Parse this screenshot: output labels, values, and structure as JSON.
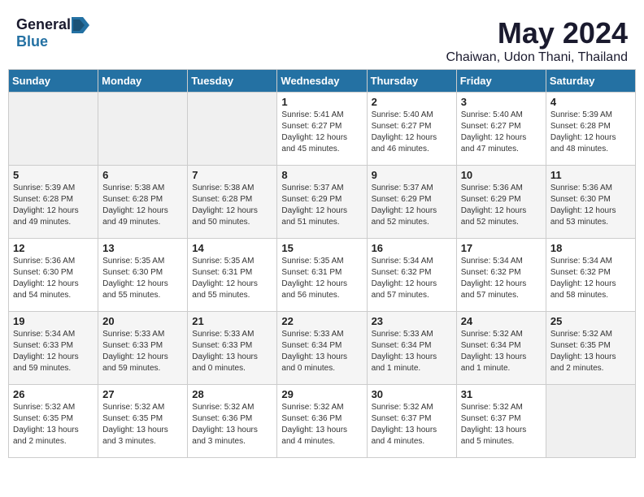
{
  "header": {
    "logo_general": "General",
    "logo_blue": "Blue",
    "month": "May 2024",
    "location": "Chaiwan, Udon Thani, Thailand"
  },
  "weekdays": [
    "Sunday",
    "Monday",
    "Tuesday",
    "Wednesday",
    "Thursday",
    "Friday",
    "Saturday"
  ],
  "weeks": [
    [
      {
        "day": "",
        "info": ""
      },
      {
        "day": "",
        "info": ""
      },
      {
        "day": "",
        "info": ""
      },
      {
        "day": "1",
        "info": "Sunrise: 5:41 AM\nSunset: 6:27 PM\nDaylight: 12 hours\nand 45 minutes."
      },
      {
        "day": "2",
        "info": "Sunrise: 5:40 AM\nSunset: 6:27 PM\nDaylight: 12 hours\nand 46 minutes."
      },
      {
        "day": "3",
        "info": "Sunrise: 5:40 AM\nSunset: 6:27 PM\nDaylight: 12 hours\nand 47 minutes."
      },
      {
        "day": "4",
        "info": "Sunrise: 5:39 AM\nSunset: 6:28 PM\nDaylight: 12 hours\nand 48 minutes."
      }
    ],
    [
      {
        "day": "5",
        "info": "Sunrise: 5:39 AM\nSunset: 6:28 PM\nDaylight: 12 hours\nand 49 minutes."
      },
      {
        "day": "6",
        "info": "Sunrise: 5:38 AM\nSunset: 6:28 PM\nDaylight: 12 hours\nand 49 minutes."
      },
      {
        "day": "7",
        "info": "Sunrise: 5:38 AM\nSunset: 6:28 PM\nDaylight: 12 hours\nand 50 minutes."
      },
      {
        "day": "8",
        "info": "Sunrise: 5:37 AM\nSunset: 6:29 PM\nDaylight: 12 hours\nand 51 minutes."
      },
      {
        "day": "9",
        "info": "Sunrise: 5:37 AM\nSunset: 6:29 PM\nDaylight: 12 hours\nand 52 minutes."
      },
      {
        "day": "10",
        "info": "Sunrise: 5:36 AM\nSunset: 6:29 PM\nDaylight: 12 hours\nand 52 minutes."
      },
      {
        "day": "11",
        "info": "Sunrise: 5:36 AM\nSunset: 6:30 PM\nDaylight: 12 hours\nand 53 minutes."
      }
    ],
    [
      {
        "day": "12",
        "info": "Sunrise: 5:36 AM\nSunset: 6:30 PM\nDaylight: 12 hours\nand 54 minutes."
      },
      {
        "day": "13",
        "info": "Sunrise: 5:35 AM\nSunset: 6:30 PM\nDaylight: 12 hours\nand 55 minutes."
      },
      {
        "day": "14",
        "info": "Sunrise: 5:35 AM\nSunset: 6:31 PM\nDaylight: 12 hours\nand 55 minutes."
      },
      {
        "day": "15",
        "info": "Sunrise: 5:35 AM\nSunset: 6:31 PM\nDaylight: 12 hours\nand 56 minutes."
      },
      {
        "day": "16",
        "info": "Sunrise: 5:34 AM\nSunset: 6:32 PM\nDaylight: 12 hours\nand 57 minutes."
      },
      {
        "day": "17",
        "info": "Sunrise: 5:34 AM\nSunset: 6:32 PM\nDaylight: 12 hours\nand 57 minutes."
      },
      {
        "day": "18",
        "info": "Sunrise: 5:34 AM\nSunset: 6:32 PM\nDaylight: 12 hours\nand 58 minutes."
      }
    ],
    [
      {
        "day": "19",
        "info": "Sunrise: 5:34 AM\nSunset: 6:33 PM\nDaylight: 12 hours\nand 59 minutes."
      },
      {
        "day": "20",
        "info": "Sunrise: 5:33 AM\nSunset: 6:33 PM\nDaylight: 12 hours\nand 59 minutes."
      },
      {
        "day": "21",
        "info": "Sunrise: 5:33 AM\nSunset: 6:33 PM\nDaylight: 13 hours\nand 0 minutes."
      },
      {
        "day": "22",
        "info": "Sunrise: 5:33 AM\nSunset: 6:34 PM\nDaylight: 13 hours\nand 0 minutes."
      },
      {
        "day": "23",
        "info": "Sunrise: 5:33 AM\nSunset: 6:34 PM\nDaylight: 13 hours\nand 1 minute."
      },
      {
        "day": "24",
        "info": "Sunrise: 5:32 AM\nSunset: 6:34 PM\nDaylight: 13 hours\nand 1 minute."
      },
      {
        "day": "25",
        "info": "Sunrise: 5:32 AM\nSunset: 6:35 PM\nDaylight: 13 hours\nand 2 minutes."
      }
    ],
    [
      {
        "day": "26",
        "info": "Sunrise: 5:32 AM\nSunset: 6:35 PM\nDaylight: 13 hours\nand 2 minutes."
      },
      {
        "day": "27",
        "info": "Sunrise: 5:32 AM\nSunset: 6:35 PM\nDaylight: 13 hours\nand 3 minutes."
      },
      {
        "day": "28",
        "info": "Sunrise: 5:32 AM\nSunset: 6:36 PM\nDaylight: 13 hours\nand 3 minutes."
      },
      {
        "day": "29",
        "info": "Sunrise: 5:32 AM\nSunset: 6:36 PM\nDaylight: 13 hours\nand 4 minutes."
      },
      {
        "day": "30",
        "info": "Sunrise: 5:32 AM\nSunset: 6:37 PM\nDaylight: 13 hours\nand 4 minutes."
      },
      {
        "day": "31",
        "info": "Sunrise: 5:32 AM\nSunset: 6:37 PM\nDaylight: 13 hours\nand 5 minutes."
      },
      {
        "day": "",
        "info": ""
      }
    ]
  ]
}
